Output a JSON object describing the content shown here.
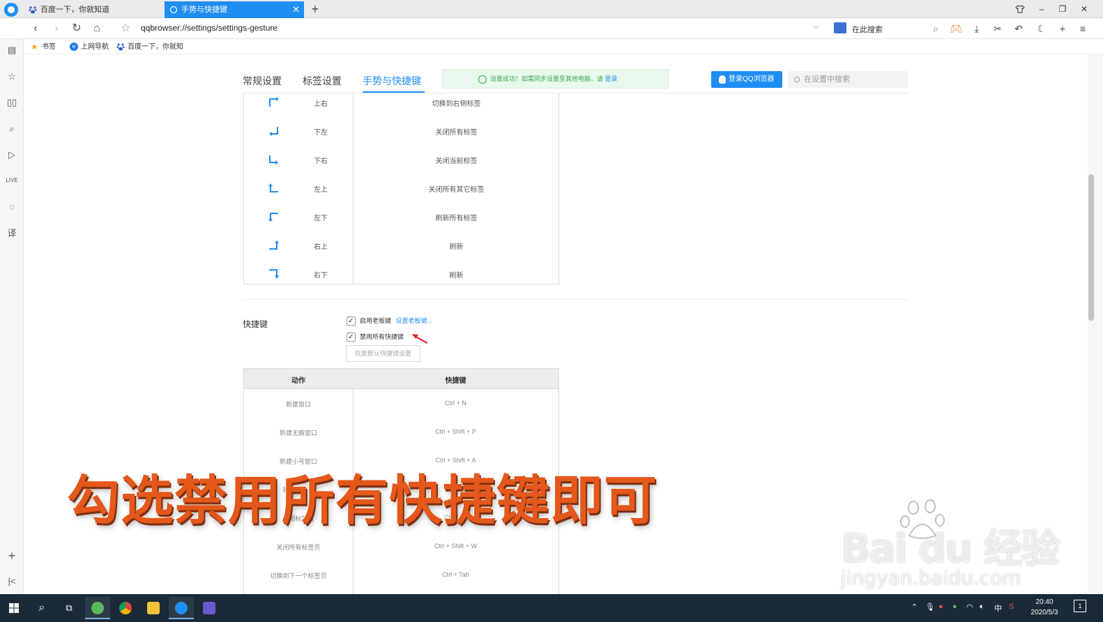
{
  "browser": {
    "tabs": [
      {
        "label": "百度一下，你就知道",
        "active": false
      },
      {
        "label": "手势与快捷键",
        "active": true
      }
    ],
    "new_tab_symbol": "+",
    "window_controls": [
      "shirt-icon",
      "minimize-icon",
      "restore-icon",
      "close-icon"
    ],
    "url": "qqbrowser://settings/settings-gesture",
    "search_placeholder": "在此搜索",
    "bookmarks": [
      {
        "label": "书签",
        "icon": "star-icon"
      },
      {
        "label": "上网导航",
        "icon": "ie-icon"
      },
      {
        "label": "百度一下，你就知",
        "icon": "baidu-paw-icon"
      }
    ],
    "accent_color": "#1f8ef1"
  },
  "settings": {
    "tabs": [
      {
        "label": "常规设置",
        "active": false
      },
      {
        "label": "标签设置",
        "active": false
      },
      {
        "label": "手势与快捷键",
        "active": true
      }
    ],
    "notice": {
      "text": "设置成功！如需同步设置至其他电脑，请",
      "link": "登录",
      "color": "#36a852"
    },
    "login_button": "登录QQ浏览器",
    "search_placeholder": "在设置中搜索",
    "gestures": [
      {
        "direction": "上右",
        "action": "切换到右侧标签",
        "icon": "gesture-up-right-icon"
      },
      {
        "direction": "下左",
        "action": "关闭所有标签",
        "icon": "gesture-down-left-icon"
      },
      {
        "direction": "下右",
        "action": "关闭当前标签",
        "icon": "gesture-down-right-icon"
      },
      {
        "direction": "左上",
        "action": "关闭所有其它标签",
        "icon": "gesture-left-up-icon"
      },
      {
        "direction": "左下",
        "action": "刷新所有标签",
        "icon": "gesture-left-down-icon"
      },
      {
        "direction": "右上",
        "action": "刷新",
        "icon": "gesture-right-up-icon"
      },
      {
        "direction": "右下",
        "action": "刷新",
        "icon": "gesture-right-down-icon"
      }
    ],
    "shortcuts_section": {
      "label": "快捷键",
      "enable_boss_key": {
        "label": "启用老板键",
        "checked": true,
        "link": "设置老板键..."
      },
      "disable_all": {
        "label": "禁用所有快捷键",
        "checked": true
      },
      "restore_button": "恢复默认快捷键设置",
      "table_headers": {
        "action": "动作",
        "shortcut": "快捷键"
      },
      "rows": [
        {
          "action": "新建窗口",
          "shortcut": "Ctrl + N"
        },
        {
          "action": "新建无痕窗口",
          "shortcut": "Ctrl + Shift + P"
        },
        {
          "action": "新建小号窗口",
          "shortcut": "Ctrl + Shift + A"
        },
        {
          "action": "新建标签页",
          "shortcut": "Ctrl + T"
        },
        {
          "action": "关闭标签页",
          "shortcut": "Ctrl + W"
        },
        {
          "action": "关闭所有标签页",
          "shortcut": "Ctrl + Shift + W"
        },
        {
          "action": "切换到下一个标签页",
          "shortcut": "Ctrl + Tab"
        }
      ]
    }
  },
  "overlay": {
    "caption": "勾选禁用所有快捷键即可",
    "caption_color": "#e4581b",
    "watermark": "Bai du 经验",
    "watermark_sub": "jingyan.baidu.com"
  },
  "taskbar": {
    "time": "20:40",
    "date": "2020/5/3",
    "ime": "中",
    "notification_count": "1"
  }
}
